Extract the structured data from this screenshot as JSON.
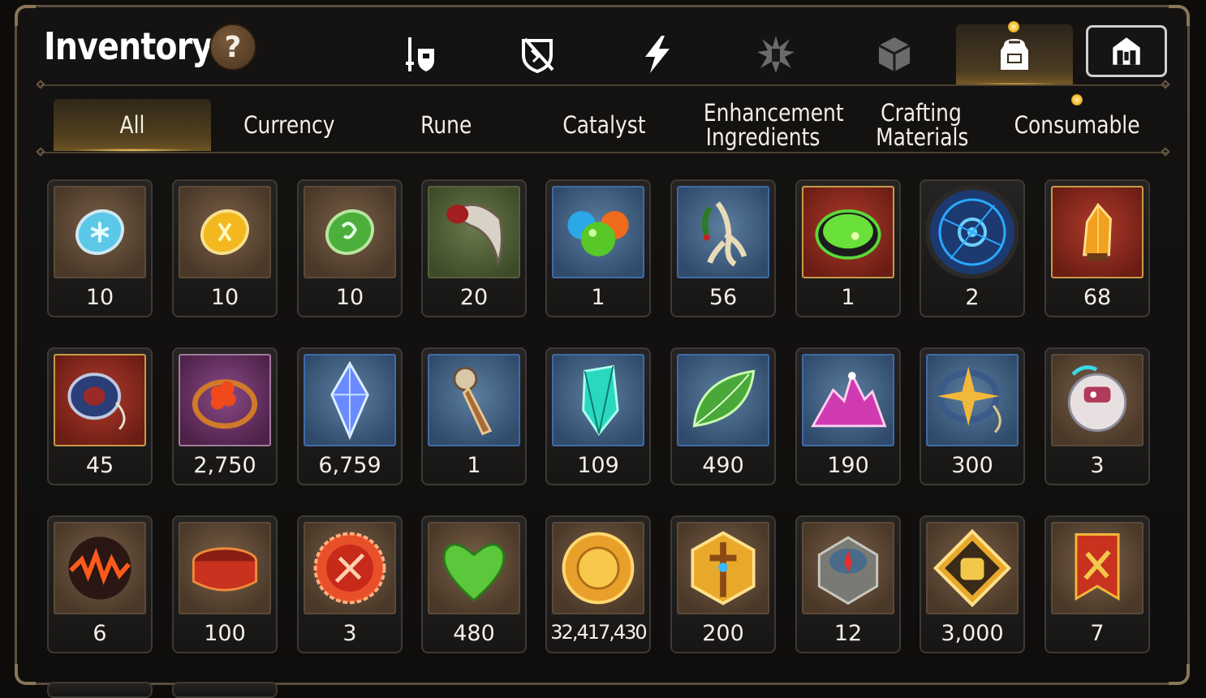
{
  "header": {
    "title": "Inventory",
    "help_label": "?"
  },
  "category_icons": [
    {
      "name": "sword-shield-icon",
      "active": false
    },
    {
      "name": "broken-shield-icon",
      "active": false
    },
    {
      "name": "lightning-icon",
      "active": false
    },
    {
      "name": "star-burst-icon",
      "active": false
    },
    {
      "name": "cube-icon",
      "active": false
    },
    {
      "name": "backpack-icon",
      "active": true
    },
    {
      "name": "guild-castle-icon",
      "active": false
    }
  ],
  "subtabs": [
    {
      "label": "All",
      "active": true
    },
    {
      "label": "Currency",
      "active": false
    },
    {
      "label": "Rune",
      "active": false
    },
    {
      "label": "Catalyst",
      "active": false
    },
    {
      "label": "Enhancement Ingredients",
      "active": false
    },
    {
      "label": "Crafting Materials",
      "active": false
    },
    {
      "label": "Consumable",
      "active": false
    }
  ],
  "items": [
    {
      "icon": "blue-rune-stone-icon",
      "count": "10"
    },
    {
      "icon": "yellow-rune-stone-icon",
      "count": "10"
    },
    {
      "icon": "green-rune-stone-icon",
      "count": "10"
    },
    {
      "icon": "claw-icon",
      "count": "20"
    },
    {
      "icon": "slime-orbs-icon",
      "count": "1"
    },
    {
      "icon": "ginseng-root-icon",
      "count": "56"
    },
    {
      "icon": "green-potion-bowl-icon",
      "count": "1"
    },
    {
      "icon": "blue-rune-circle-icon",
      "count": "2"
    },
    {
      "icon": "orange-crystal-icon",
      "count": "68"
    },
    {
      "icon": "blue-ring-pendant-icon",
      "count": "45"
    },
    {
      "icon": "red-flower-ring-icon",
      "count": "2,750"
    },
    {
      "icon": "blue-crystal-icon",
      "count": "6,759"
    },
    {
      "icon": "key-pendant-icon",
      "count": "1"
    },
    {
      "icon": "teal-crystal-icon",
      "count": "109"
    },
    {
      "icon": "green-leaf-icon",
      "count": "490"
    },
    {
      "icon": "pink-crystal-pile-icon",
      "count": "190"
    },
    {
      "icon": "gold-star-pendant-icon",
      "count": "300"
    },
    {
      "icon": "robot-orb-icon",
      "count": "3"
    },
    {
      "icon": "lava-orb-icon",
      "count": "6"
    },
    {
      "icon": "red-ring-icon",
      "count": "100"
    },
    {
      "icon": "red-badge-icon",
      "count": "3"
    },
    {
      "icon": "green-heart-icon",
      "count": "480"
    },
    {
      "icon": "sun-coin-icon",
      "count": "32,417,430"
    },
    {
      "icon": "gold-sword-emblem-icon",
      "count": "200"
    },
    {
      "icon": "stone-compass-icon",
      "count": "12"
    },
    {
      "icon": "fist-emblem-icon",
      "count": "3,000"
    },
    {
      "icon": "war-banner-icon",
      "count": "7"
    }
  ],
  "colors": {
    "accent_gold": "#f2b62a",
    "frame": "#5a4d3c",
    "text": "#f2ece0"
  }
}
